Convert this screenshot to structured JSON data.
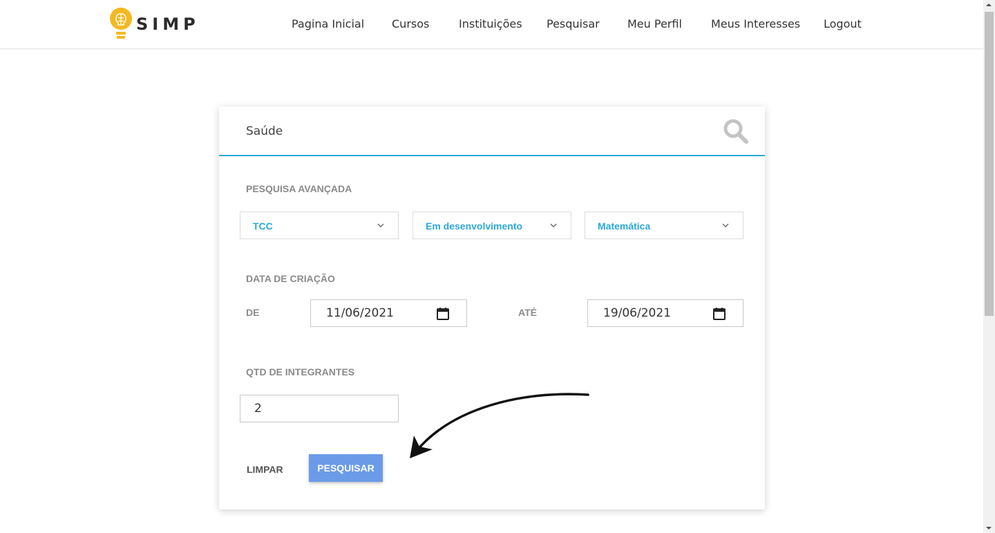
{
  "header": {
    "logo_text": "SIMP",
    "nav": [
      {
        "label": "Pagina Inicial"
      },
      {
        "label": "Cursos"
      },
      {
        "label": "Instituições"
      },
      {
        "label": "Pesquisar"
      },
      {
        "label": "Meu Perfil"
      },
      {
        "label": "Meus Interesses"
      },
      {
        "label": "Logout"
      }
    ]
  },
  "search": {
    "value": "Saúde",
    "icon": "search-icon"
  },
  "advanced": {
    "title": "PESQUISA AVANÇADA",
    "filters": [
      {
        "value": "TCC"
      },
      {
        "value": "Em desenvolvimento"
      },
      {
        "value": "Matemática"
      }
    ]
  },
  "date_section": {
    "title": "DATA DE CRIAÇÃO",
    "from_label": "DE",
    "from_value": "11/06/2021",
    "to_label": "ATÉ",
    "to_value": "19/06/2021"
  },
  "members": {
    "title": "QTD DE INTEGRANTES",
    "value": "2"
  },
  "actions": {
    "clear_label": "LIMPAR",
    "search_label": "PESQUISAR"
  },
  "colors": {
    "accent": "#2aa8d8",
    "button": "#6b9be8",
    "logo": "#f5b820"
  }
}
